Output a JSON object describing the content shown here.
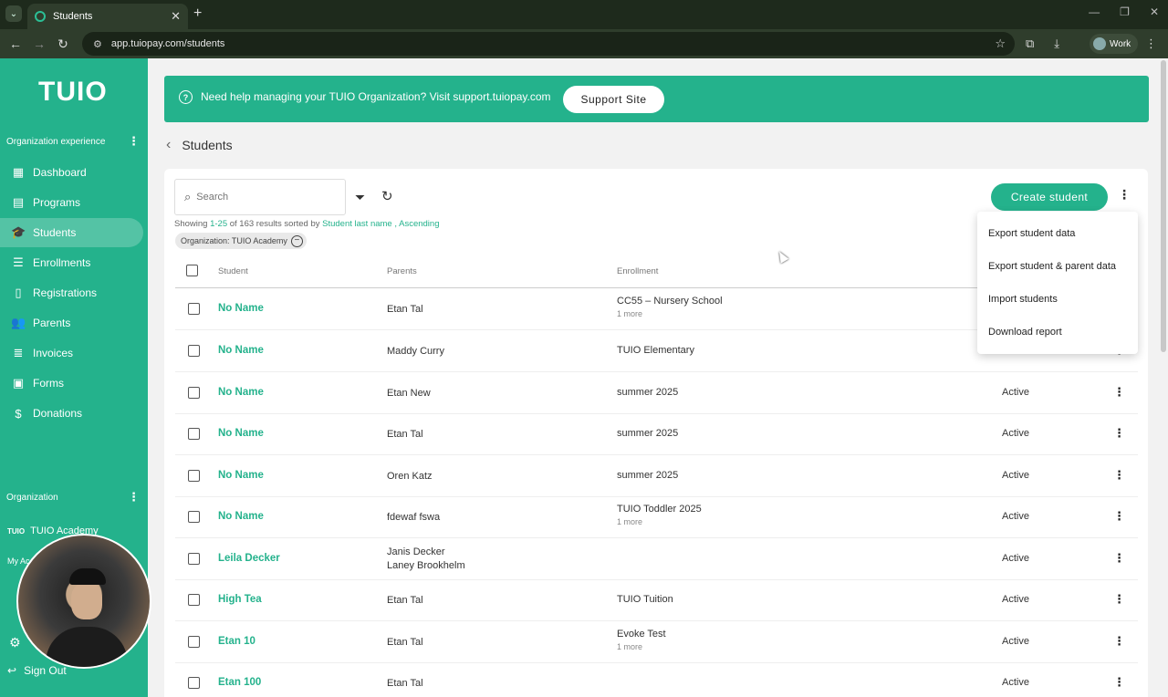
{
  "browser": {
    "tab_title": "Students",
    "url": "app.tuiopay.com/students",
    "profile_label": "Work"
  },
  "sidebar": {
    "logo": "TUIO",
    "section_org_experience": "Organization experience",
    "items": [
      {
        "label": "Dashboard",
        "icon": "dashboard-icon"
      },
      {
        "label": "Programs",
        "icon": "clipboard-icon"
      },
      {
        "label": "Students",
        "icon": "graduation-cap-icon",
        "active": true
      },
      {
        "label": "Enrollments",
        "icon": "list-icon"
      },
      {
        "label": "Registrations",
        "icon": "document-icon"
      },
      {
        "label": "Parents",
        "icon": "people-icon"
      },
      {
        "label": "Invoices",
        "icon": "invoice-icon"
      },
      {
        "label": "Forms",
        "icon": "form-icon"
      },
      {
        "label": "Donations",
        "icon": "dollar-icon"
      }
    ],
    "section_organization": "Organization",
    "org_logo": "TUIO",
    "org_name": "TUIO Academy",
    "my_account": "My Ac",
    "sign_out": "Sign Out"
  },
  "banner": {
    "text": "Need help managing your TUIO Organization? Visit support.tuiopay.com",
    "button": "Support Site"
  },
  "page": {
    "title": "Students"
  },
  "toolbar": {
    "search_placeholder": "Search",
    "showing_prefix": "Showing ",
    "showing_range": "1-25",
    "showing_mid": " of 163 results sorted by ",
    "sort_field": "Student last name",
    "sort_sep": " , ",
    "sort_dir": "Ascending",
    "filter_chip": "Organization: TUIO Academy",
    "create_button": "Create student"
  },
  "menu": {
    "items": [
      "Export student data",
      "Export student & parent data",
      "Import students",
      "Download report"
    ]
  },
  "table": {
    "headers": {
      "student": "Student",
      "parents": "Parents",
      "enrollment": "Enrollment"
    },
    "rows": [
      {
        "student": "No Name",
        "parents": "Etan Tal",
        "parents2": "",
        "enrollment": "CC55 – Nursery School",
        "more": "1 more",
        "status": ""
      },
      {
        "student": "No Name",
        "parents": "Maddy Curry",
        "parents2": "",
        "enrollment": "TUIO Elementary",
        "more": "",
        "status": ""
      },
      {
        "student": "No Name",
        "parents": "Etan New",
        "parents2": "",
        "enrollment": "summer 2025",
        "more": "",
        "status": "Active"
      },
      {
        "student": "No Name",
        "parents": "Etan Tal",
        "parents2": "",
        "enrollment": "summer 2025",
        "more": "",
        "status": "Active"
      },
      {
        "student": "No Name",
        "parents": "Oren Katz",
        "parents2": "",
        "enrollment": "summer 2025",
        "more": "",
        "status": "Active"
      },
      {
        "student": "No Name",
        "parents": "fdewaf fswa",
        "parents2": "",
        "enrollment": "TUIO Toddler 2025",
        "more": "1 more",
        "status": "Active"
      },
      {
        "student": "Leila Decker",
        "parents": "Janis Decker",
        "parents2": "Laney Brookhelm",
        "enrollment": "",
        "more": "",
        "status": "Active"
      },
      {
        "student": "High Tea",
        "parents": "Etan Tal",
        "parents2": "",
        "enrollment": "TUIO Tuition",
        "more": "",
        "status": "Active"
      },
      {
        "student": "Etan 10",
        "parents": "Etan Tal",
        "parents2": "",
        "enrollment": "Evoke Test",
        "more": "1 more",
        "status": "Active"
      },
      {
        "student": "Etan 100",
        "parents": "Etan Tal",
        "parents2": "",
        "enrollment": "",
        "more": "",
        "status": "Active"
      }
    ]
  },
  "colors": {
    "brand": "#24b28c"
  }
}
